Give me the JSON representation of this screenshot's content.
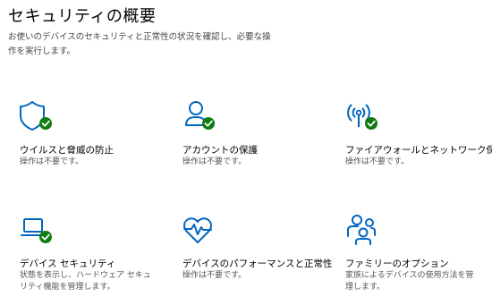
{
  "page": {
    "title": "セキュリティの概要",
    "description": "お使いのデバイスのセキュリティと正常性の状況を確認し、必要な操作を実行します。"
  },
  "colors": {
    "accent": "#0067c0",
    "ok": "#107c10"
  },
  "tiles": [
    {
      "icon": "shield-icon",
      "status_icon": "check-icon",
      "name": "ウイルスと脅威の防止",
      "status": "操作は不要です。"
    },
    {
      "icon": "person-icon",
      "status_icon": "check-icon",
      "name": "アカウントの保護",
      "status": "操作は不要です。"
    },
    {
      "icon": "wireless-antenna-icon",
      "status_icon": "check-icon",
      "name": "ファイアウォールとネットワーク保護",
      "status": "操作は不要です。"
    },
    {
      "icon": "laptop-icon",
      "status_icon": "check-icon",
      "name": "デバイス セキュリティ",
      "status": "状態を表示し、ハードウェア セキュリティ機能を管理します。"
    },
    {
      "icon": "heart-pulse-icon",
      "name": "デバイスのパフォーマンスと正常性",
      "status": "操作は不要です。"
    },
    {
      "icon": "family-icon",
      "name": "ファミリーのオプション",
      "status": "家族によるデバイスの使用方法を管理します。"
    }
  ]
}
